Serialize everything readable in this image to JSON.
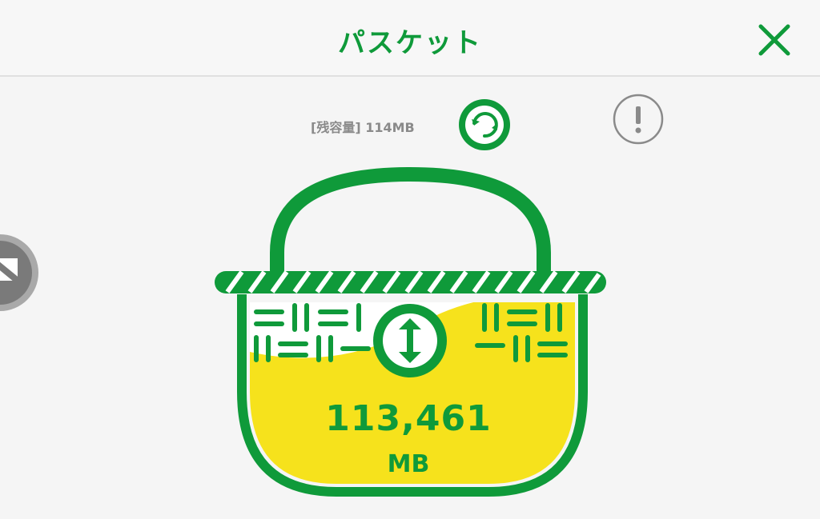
{
  "header": {
    "title": "パスケット",
    "close_icon": "close-icon"
  },
  "status": {
    "remaining_label": "[残容量] 114MB"
  },
  "actions": {
    "refresh_icon": "refresh-icon",
    "info_icon": "exclamation-icon",
    "side_icon": "gift-icon"
  },
  "basket": {
    "amount": "113,461",
    "unit": "MB",
    "transfer_icon": "up-down-arrow-icon"
  },
  "colors": {
    "green": "#0f9a3a",
    "yellow": "#f6e21c",
    "gray": "#8a8a8a"
  }
}
